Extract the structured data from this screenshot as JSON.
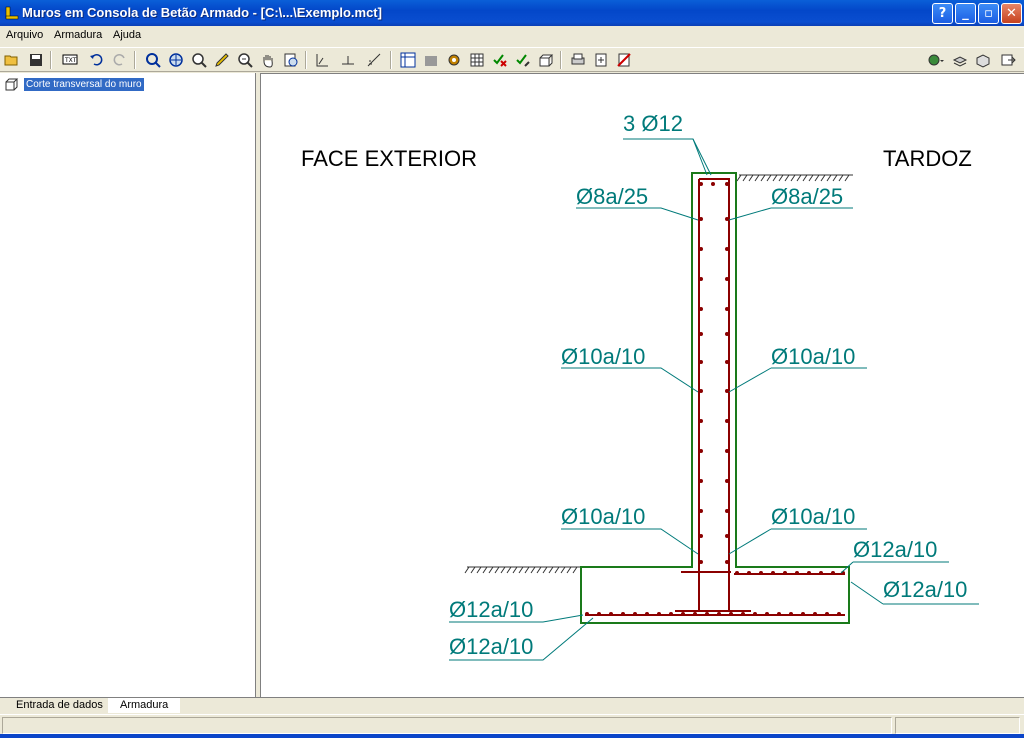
{
  "window": {
    "title": "Muros em Consola de Betão Armado - [C:\\...\\Exemplo.mct]"
  },
  "menu": [
    "Arquivo",
    "Armadura",
    "Ajuda"
  ],
  "toolbar": {
    "icons": [
      "open-icon",
      "save-icon",
      "text-icon",
      "undo-icon",
      "redo-icon",
      "zoom-pan-icon",
      "zoom-extents-icon",
      "zoom-window-icon",
      "pencil-icon",
      "zoom-previous-icon",
      "pan-hand-icon",
      "zoom-scale-icon",
      "axis-icon",
      "dimension-icon",
      "measure-icon",
      "layout-icon",
      "folder-icon",
      "settings-icon",
      "table-icon",
      "check-x-icon",
      "edit-check-icon",
      "box-icon",
      "print-icon",
      "add-icon",
      "delete-icon",
      "globe-icon",
      "layers-icon",
      "render-icon",
      "export-icon"
    ]
  },
  "tree": {
    "item": "Corte transversal do muro"
  },
  "tabs": [
    "Entrada de dados",
    "Armadura"
  ],
  "drawing": {
    "label_left": "FACE EXTERIOR",
    "label_right": "TARDOZ",
    "top_bars": "3 Ø12",
    "stem_top_left": "Ø8a/25",
    "stem_top_right": "Ø8a/25",
    "stem_mid_left": "Ø10a/10",
    "stem_mid_right": "Ø10a/10",
    "stem_bot_left": "Ø10a/10",
    "stem_bot_right": "Ø10a/10",
    "footing_top_right": "Ø12a/10",
    "footing_right": "Ø12a/10",
    "footing_left_top": "Ø12a/10",
    "footing_left_bottom": "Ø12a/10",
    "colors": {
      "concrete": "#1a7a1a",
      "rebar": "#8b0000",
      "label": "#007a7a"
    }
  }
}
